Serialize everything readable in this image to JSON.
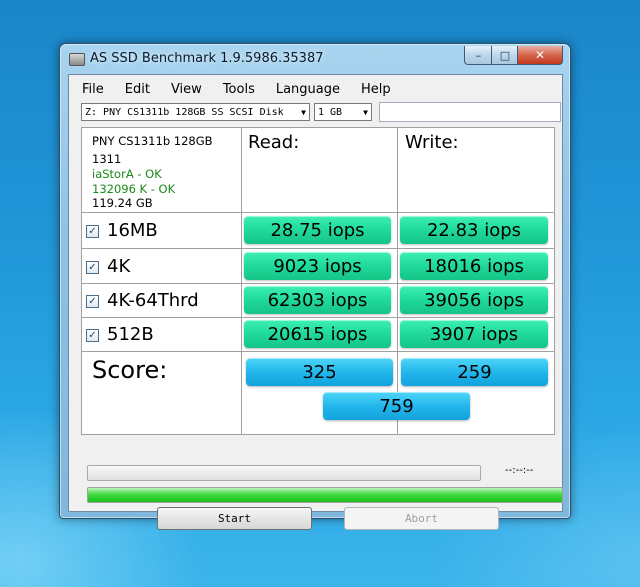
{
  "window": {
    "title": "AS SSD Benchmark 1.9.5986.35387"
  },
  "menu": [
    "File",
    "Edit",
    "View",
    "Tools",
    "Language",
    "Help"
  ],
  "drive_select": {
    "value": "Z: PNY CS1311b 128GB SS SCSI Disk"
  },
  "size_select": {
    "value": "1 GB"
  },
  "info": {
    "model": "PNY CS1311b 128GB",
    "firmware": "1311",
    "driver": "iaStorA - OK",
    "alignment": "132096 K - OK",
    "capacity": "119.24 GB"
  },
  "headers": {
    "read": "Read:",
    "write": "Write:"
  },
  "tests": [
    {
      "label": "16MB",
      "read": "28.75 iops",
      "write": "22.83 iops"
    },
    {
      "label": "4K",
      "read": "9023 iops",
      "write": "18016 iops"
    },
    {
      "label": "4K-64Thrd",
      "read": "62303 iops",
      "write": "39056 iops"
    },
    {
      "label": "512B",
      "read": "20615 iops",
      "write": "3907 iops"
    }
  ],
  "score": {
    "label": "Score:",
    "read": "325",
    "write": "259",
    "total": "759"
  },
  "status": {
    "time": "--:--:--"
  },
  "progress": {
    "main_percent": 100,
    "top_percent": 0
  },
  "buttons": {
    "start": "Start",
    "abort": "Abort"
  },
  "colors": {
    "result_green": "#1fd99a",
    "score_blue": "#20b4ea",
    "progress_green": "#43d943"
  }
}
